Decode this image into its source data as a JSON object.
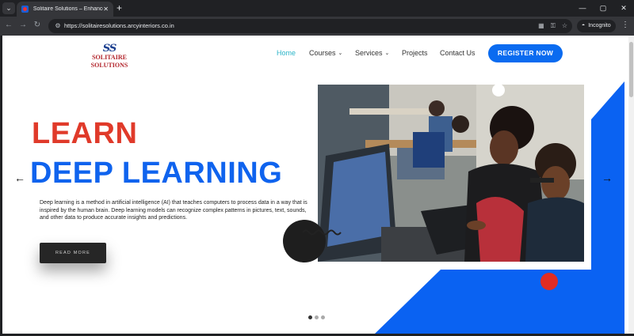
{
  "browser": {
    "tab_title": "Solitaire Solutions – Enhance y",
    "tab_close": "✕",
    "new_tab": "+",
    "url": "https://solitairesolutions.arcyinteriors.co.in",
    "incognito_label": "Incognito",
    "window_controls": [
      "—",
      "▢",
      "✕"
    ]
  },
  "site": {
    "logo_mark": "SS",
    "logo_text": "SOLITAIRE SOLUTIONS",
    "nav": {
      "home": "Home",
      "courses": "Courses",
      "services": "Services",
      "projects": "Projects",
      "contact": "Contact Us",
      "chevron": "⌄"
    },
    "register_label": "REGISTER NOW",
    "hero": {
      "line1": "LEARN",
      "line2": "DEEP LEARNING",
      "description": "Deep learning is a method in artificial intelligence (AI) that teaches computers to process data in a way that is inspired by the human brain. Deep learning models can recognize complex patterns in pictures, text, sounds, and other data to produce accurate insights and predictions.",
      "read_more": "READ MORE",
      "prev_arrow": "←",
      "next_arrow": "→",
      "slide_count": 3,
      "active_slide": 1
    },
    "colors": {
      "accent_blue": "#0f63ee",
      "accent_red": "#e03a2a",
      "nav_active": "#2bb4c8"
    }
  }
}
